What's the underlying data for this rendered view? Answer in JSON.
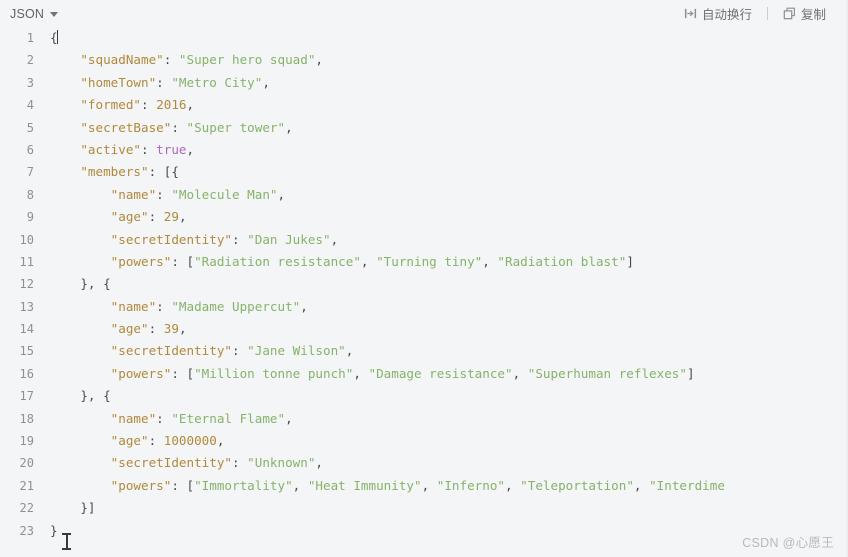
{
  "toolbar": {
    "language_label": "JSON",
    "language_icon": "chevron-down-icon",
    "wrap_label": "自动换行",
    "wrap_icon": "word-wrap-icon",
    "copy_label": "复制",
    "copy_icon": "copy-icon"
  },
  "editor": {
    "total_lines": 23,
    "lines": [
      {
        "num": "1",
        "tokens": [
          {
            "t": "punc",
            "v": "{"
          }
        ],
        "caret": true
      },
      {
        "num": "2",
        "tokens": [
          {
            "t": "punc",
            "v": "    "
          },
          {
            "t": "key",
            "v": "\"squadName\""
          },
          {
            "t": "punc",
            "v": ": "
          },
          {
            "t": "str",
            "v": "\"Super hero squad\""
          },
          {
            "t": "punc",
            "v": ","
          }
        ]
      },
      {
        "num": "3",
        "tokens": [
          {
            "t": "punc",
            "v": "    "
          },
          {
            "t": "key",
            "v": "\"homeTown\""
          },
          {
            "t": "punc",
            "v": ": "
          },
          {
            "t": "str",
            "v": "\"Metro City\""
          },
          {
            "t": "punc",
            "v": ","
          }
        ]
      },
      {
        "num": "4",
        "tokens": [
          {
            "t": "punc",
            "v": "    "
          },
          {
            "t": "key",
            "v": "\"formed\""
          },
          {
            "t": "punc",
            "v": ": "
          },
          {
            "t": "num",
            "v": "2016"
          },
          {
            "t": "punc",
            "v": ","
          }
        ]
      },
      {
        "num": "5",
        "tokens": [
          {
            "t": "punc",
            "v": "    "
          },
          {
            "t": "key",
            "v": "\"secretBase\""
          },
          {
            "t": "punc",
            "v": ": "
          },
          {
            "t": "str",
            "v": "\"Super tower\""
          },
          {
            "t": "punc",
            "v": ","
          }
        ]
      },
      {
        "num": "6",
        "tokens": [
          {
            "t": "punc",
            "v": "    "
          },
          {
            "t": "key",
            "v": "\"active\""
          },
          {
            "t": "punc",
            "v": ": "
          },
          {
            "t": "bool",
            "v": "true"
          },
          {
            "t": "punc",
            "v": ","
          }
        ]
      },
      {
        "num": "7",
        "tokens": [
          {
            "t": "punc",
            "v": "    "
          },
          {
            "t": "key",
            "v": "\"members\""
          },
          {
            "t": "punc",
            "v": ": [{"
          }
        ]
      },
      {
        "num": "8",
        "tokens": [
          {
            "t": "punc",
            "v": "        "
          },
          {
            "t": "key",
            "v": "\"name\""
          },
          {
            "t": "punc",
            "v": ": "
          },
          {
            "t": "str",
            "v": "\"Molecule Man\""
          },
          {
            "t": "punc",
            "v": ","
          }
        ]
      },
      {
        "num": "9",
        "tokens": [
          {
            "t": "punc",
            "v": "        "
          },
          {
            "t": "key",
            "v": "\"age\""
          },
          {
            "t": "punc",
            "v": ": "
          },
          {
            "t": "num",
            "v": "29"
          },
          {
            "t": "punc",
            "v": ","
          }
        ]
      },
      {
        "num": "10",
        "tokens": [
          {
            "t": "punc",
            "v": "        "
          },
          {
            "t": "key",
            "v": "\"secretIdentity\""
          },
          {
            "t": "punc",
            "v": ": "
          },
          {
            "t": "str",
            "v": "\"Dan Jukes\""
          },
          {
            "t": "punc",
            "v": ","
          }
        ]
      },
      {
        "num": "11",
        "tokens": [
          {
            "t": "punc",
            "v": "        "
          },
          {
            "t": "key",
            "v": "\"powers\""
          },
          {
            "t": "punc",
            "v": ": ["
          },
          {
            "t": "str",
            "v": "\"Radiation resistance\""
          },
          {
            "t": "punc",
            "v": ", "
          },
          {
            "t": "str",
            "v": "\"Turning tiny\""
          },
          {
            "t": "punc",
            "v": ", "
          },
          {
            "t": "str",
            "v": "\"Radiation blast\""
          },
          {
            "t": "punc",
            "v": "]"
          }
        ]
      },
      {
        "num": "12",
        "tokens": [
          {
            "t": "punc",
            "v": "    }, {"
          }
        ]
      },
      {
        "num": "13",
        "tokens": [
          {
            "t": "punc",
            "v": "        "
          },
          {
            "t": "key",
            "v": "\"name\""
          },
          {
            "t": "punc",
            "v": ": "
          },
          {
            "t": "str",
            "v": "\"Madame Uppercut\""
          },
          {
            "t": "punc",
            "v": ","
          }
        ]
      },
      {
        "num": "14",
        "tokens": [
          {
            "t": "punc",
            "v": "        "
          },
          {
            "t": "key",
            "v": "\"age\""
          },
          {
            "t": "punc",
            "v": ": "
          },
          {
            "t": "num",
            "v": "39"
          },
          {
            "t": "punc",
            "v": ","
          }
        ]
      },
      {
        "num": "15",
        "tokens": [
          {
            "t": "punc",
            "v": "        "
          },
          {
            "t": "key",
            "v": "\"secretIdentity\""
          },
          {
            "t": "punc",
            "v": ": "
          },
          {
            "t": "str",
            "v": "\"Jane Wilson\""
          },
          {
            "t": "punc",
            "v": ","
          }
        ]
      },
      {
        "num": "16",
        "tokens": [
          {
            "t": "punc",
            "v": "        "
          },
          {
            "t": "key",
            "v": "\"powers\""
          },
          {
            "t": "punc",
            "v": ": ["
          },
          {
            "t": "str",
            "v": "\"Million tonne punch\""
          },
          {
            "t": "punc",
            "v": ", "
          },
          {
            "t": "str",
            "v": "\"Damage resistance\""
          },
          {
            "t": "punc",
            "v": ", "
          },
          {
            "t": "str",
            "v": "\"Superhuman reflexes\""
          },
          {
            "t": "punc",
            "v": "]"
          }
        ]
      },
      {
        "num": "17",
        "tokens": [
          {
            "t": "punc",
            "v": "    }, {"
          }
        ]
      },
      {
        "num": "18",
        "tokens": [
          {
            "t": "punc",
            "v": "        "
          },
          {
            "t": "key",
            "v": "\"name\""
          },
          {
            "t": "punc",
            "v": ": "
          },
          {
            "t": "str",
            "v": "\"Eternal Flame\""
          },
          {
            "t": "punc",
            "v": ","
          }
        ]
      },
      {
        "num": "19",
        "tokens": [
          {
            "t": "punc",
            "v": "        "
          },
          {
            "t": "key",
            "v": "\"age\""
          },
          {
            "t": "punc",
            "v": ": "
          },
          {
            "t": "num",
            "v": "1000000"
          },
          {
            "t": "punc",
            "v": ","
          }
        ]
      },
      {
        "num": "20",
        "tokens": [
          {
            "t": "punc",
            "v": "        "
          },
          {
            "t": "key",
            "v": "\"secretIdentity\""
          },
          {
            "t": "punc",
            "v": ": "
          },
          {
            "t": "str",
            "v": "\"Unknown\""
          },
          {
            "t": "punc",
            "v": ","
          }
        ]
      },
      {
        "num": "21",
        "tokens": [
          {
            "t": "punc",
            "v": "        "
          },
          {
            "t": "key",
            "v": "\"powers\""
          },
          {
            "t": "punc",
            "v": ": ["
          },
          {
            "t": "str",
            "v": "\"Immortality\""
          },
          {
            "t": "punc",
            "v": ", "
          },
          {
            "t": "str",
            "v": "\"Heat Immunity\""
          },
          {
            "t": "punc",
            "v": ", "
          },
          {
            "t": "str",
            "v": "\"Inferno\""
          },
          {
            "t": "punc",
            "v": ", "
          },
          {
            "t": "str",
            "v": "\"Teleportation\""
          },
          {
            "t": "punc",
            "v": ", "
          },
          {
            "t": "str",
            "v": "\"Interdime"
          }
        ]
      },
      {
        "num": "22",
        "tokens": [
          {
            "t": "punc",
            "v": "    }]"
          }
        ]
      },
      {
        "num": "23",
        "tokens": [
          {
            "t": "punc",
            "v": "}"
          }
        ]
      }
    ]
  },
  "watermark": {
    "text": "CSDN @心愿王"
  },
  "colors": {
    "background": "#f4f5f6",
    "key": "#b1893c",
    "string": "#86b36a",
    "number": "#b1893c",
    "boolean": "#b265c4",
    "punctuation": "#4a4a4a",
    "line_number": "#8c9196",
    "toolbar_text": "#6b7075"
  }
}
